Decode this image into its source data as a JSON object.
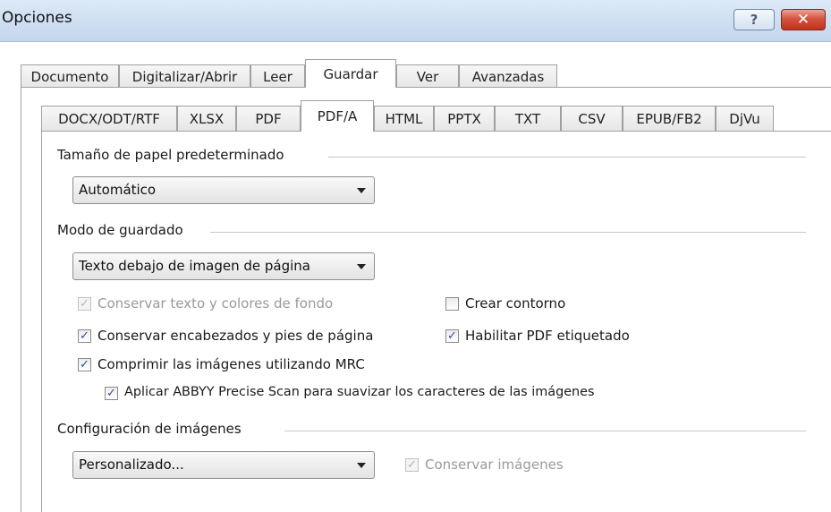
{
  "window": {
    "title": "Opciones",
    "help_label": "?",
    "close_label": "✕"
  },
  "outer_tabs": [
    "Documento",
    "Digitalizar/Abrir",
    "Leer",
    "Guardar",
    "Ver",
    "Avanzadas"
  ],
  "outer_active": "Guardar",
  "inner_tabs": [
    "DOCX/ODT/RTF",
    "XLSX",
    "PDF",
    "PDF/A",
    "HTML",
    "PPTX",
    "TXT",
    "CSV",
    "EPUB/FB2",
    "DjVu"
  ],
  "inner_active": "PDF/A",
  "paper": {
    "label": "Tamaño de papel predeterminado",
    "value": "Automático"
  },
  "save_mode": {
    "label": "Modo de guardado",
    "value": "Texto debajo de imagen de página"
  },
  "options": {
    "keep_text_bg": {
      "label": "Conservar texto y colores de fondo",
      "checked": true,
      "enabled": false
    },
    "create_outline": {
      "label": "Crear contorno",
      "checked": false,
      "enabled": true
    },
    "keep_headers": {
      "label": "Conservar encabezados y pies de página",
      "checked": true,
      "enabled": true
    },
    "tagged_pdf": {
      "label": "Habilitar PDF etiquetado",
      "checked": true,
      "enabled": true
    },
    "mrc": {
      "label": "Comprimir las imágenes utilizando MRC",
      "checked": true,
      "enabled": true
    },
    "precise_scan": {
      "label": "Aplicar ABBYY Precise Scan para suavizar los caracteres de las imágenes",
      "checked": true,
      "enabled": true
    }
  },
  "images": {
    "label": "Configuración de imágenes",
    "value": "Personalizado...",
    "keep_images": {
      "label": "Conservar imágenes",
      "checked": true,
      "enabled": false
    }
  },
  "check_mark": "✓"
}
